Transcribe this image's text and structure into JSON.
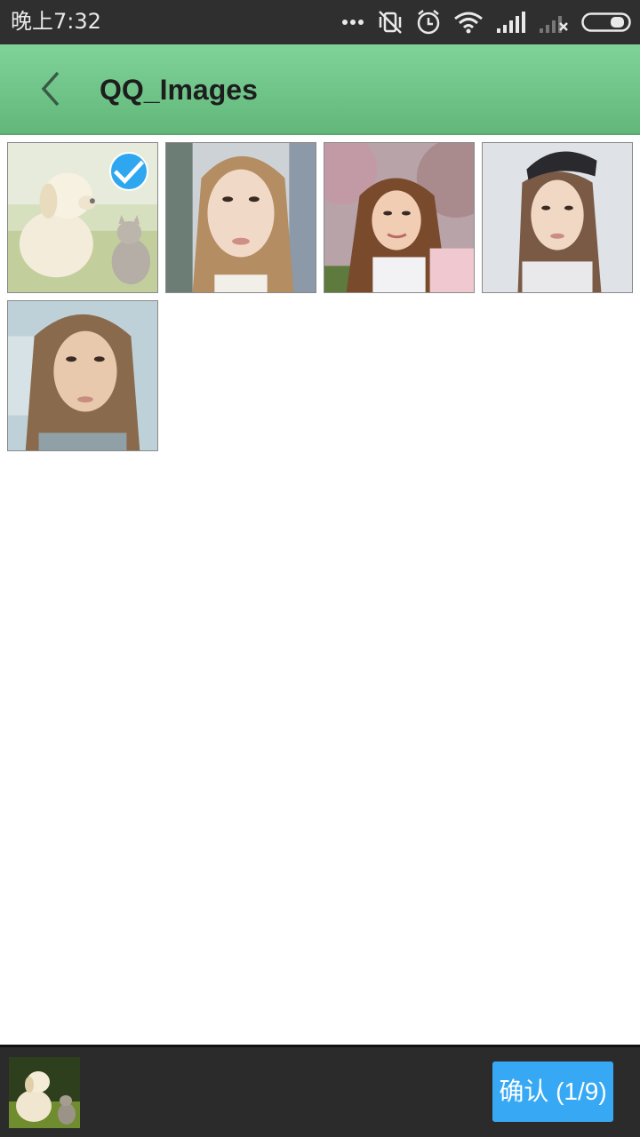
{
  "status_bar": {
    "time": "晚上7:32",
    "icons": [
      "more-dots-icon",
      "vibrate-off-icon",
      "alarm-icon",
      "wifi-icon",
      "signal-icon",
      "no-signal-icon",
      "battery-icon"
    ]
  },
  "app_bar": {
    "title": "QQ_Images",
    "back_icon": "chevron-left-icon"
  },
  "images": [
    {
      "subject": "puppy and kitten",
      "selected": true
    },
    {
      "subject": "portrait 1",
      "selected": false
    },
    {
      "subject": "portrait 2 with trees",
      "selected": false
    },
    {
      "subject": "portrait 3 with cap",
      "selected": false
    },
    {
      "subject": "portrait 4",
      "selected": false
    }
  ],
  "selection": {
    "confirm_label": "确认 (1/9)",
    "selected_count": 1,
    "max_count": 9
  },
  "colors": {
    "app_bar": "#6cc285",
    "status_bar": "#2f2f2f",
    "accent": "#37a9f4",
    "bottom_bar": "#2b2b2b"
  }
}
